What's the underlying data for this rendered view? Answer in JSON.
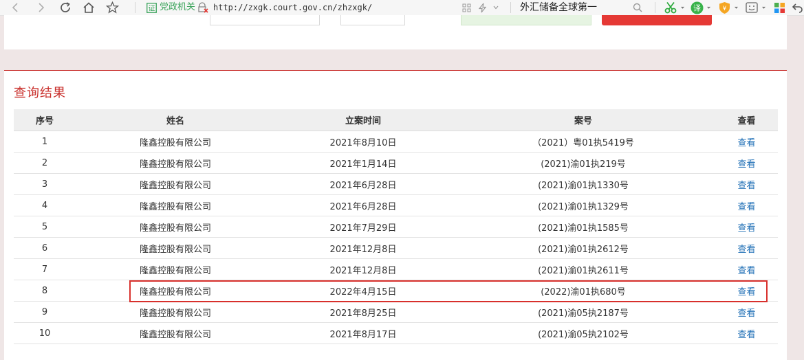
{
  "browser": {
    "address_badge": "党政机关",
    "url": "http://zxgk.court.gov.cn/zhzxgk/",
    "search_query": "外汇储备全球第一"
  },
  "results": {
    "title": "查询结果",
    "columns": [
      "序号",
      "姓名",
      "立案时间",
      "案号",
      "查看"
    ],
    "rows": [
      {
        "no": "1",
        "name": "隆鑫控股有限公司",
        "date": "2021年8月10日",
        "case": "（2021）粤01执5419号",
        "view": "查看"
      },
      {
        "no": "2",
        "name": "隆鑫控股有限公司",
        "date": "2021年1月14日",
        "case": "(2021)渝01执219号",
        "view": "查看"
      },
      {
        "no": "3",
        "name": "隆鑫控股有限公司",
        "date": "2021年6月28日",
        "case": "(2021)渝01执1330号",
        "view": "查看"
      },
      {
        "no": "4",
        "name": "隆鑫控股有限公司",
        "date": "2021年6月28日",
        "case": "(2021)渝01执1329号",
        "view": "查看"
      },
      {
        "no": "5",
        "name": "隆鑫控股有限公司",
        "date": "2021年7月29日",
        "case": "(2021)渝01执1585号",
        "view": "查看"
      },
      {
        "no": "6",
        "name": "隆鑫控股有限公司",
        "date": "2021年12月8日",
        "case": "(2021)渝01执2612号",
        "view": "查看"
      },
      {
        "no": "7",
        "name": "隆鑫控股有限公司",
        "date": "2021年12月8日",
        "case": "(2021)渝01执2611号",
        "view": "查看"
      },
      {
        "no": "8",
        "name": "隆鑫控股有限公司",
        "date": "2022年4月15日",
        "case": "(2022)渝01执680号",
        "view": "查看"
      },
      {
        "no": "9",
        "name": "隆鑫控股有限公司",
        "date": "2021年8月25日",
        "case": "(2021)渝05执2187号",
        "view": "查看"
      },
      {
        "no": "10",
        "name": "隆鑫控股有限公司",
        "date": "2021年8月17日",
        "case": "(2021)渝05执2102号",
        "view": "查看"
      }
    ]
  },
  "colors": {
    "accent": "#c9302c",
    "link": "#1f6fb6",
    "highlight": "#d8302c"
  }
}
